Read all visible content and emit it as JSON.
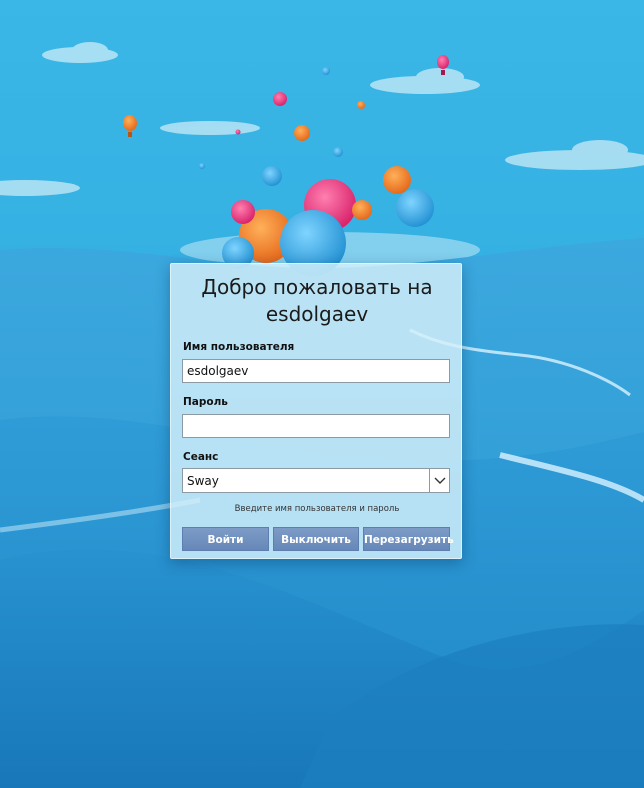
{
  "login": {
    "title": "Добро пожаловать на esdolgaev",
    "username_label": "Имя пользователя",
    "username_value": "esdolgaev",
    "password_label": "Пароль",
    "password_value": "",
    "session_label": "Сеанс",
    "session_value": "Sway",
    "hint": "Введите имя пользователя и пароль",
    "login_button": "Войти",
    "shutdown_button": "Выключить",
    "reboot_button": "Перезагрузить"
  },
  "icons": {
    "session_dropdown": "chevron-down-icon"
  },
  "colors": {
    "sky_top": "#3ab7e6",
    "sky_bottom": "#1c84c4",
    "panel_bg": "#d6f0fa",
    "button_bg": "#6f8fbf",
    "button_text": "#ffffff",
    "balloon_pink": "#e8357a",
    "balloon_orange": "#f07e2a",
    "balloon_blue": "#3aa8e0"
  }
}
